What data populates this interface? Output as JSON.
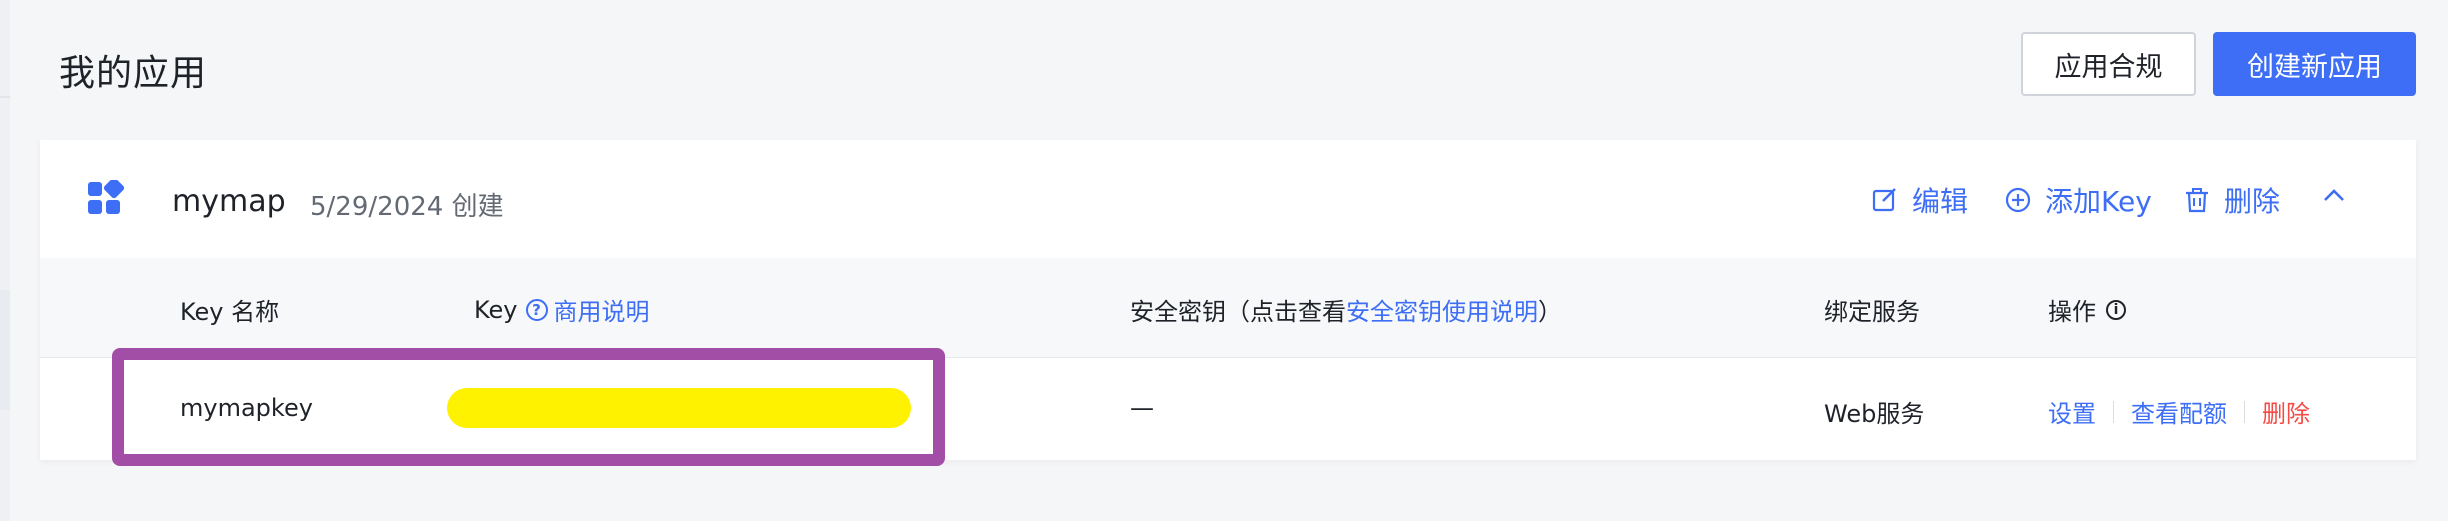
{
  "page": {
    "title": "我的应用",
    "compliance_button": "应用合规",
    "create_button": "创建新应用"
  },
  "app": {
    "name": "mymap",
    "created": "5/29/2024 创建",
    "actions": {
      "edit": "编辑",
      "add_key": "添加Key",
      "delete": "删除"
    }
  },
  "table": {
    "headers": {
      "key_name": "Key 名称",
      "key": "Key",
      "key_help": "商用说明",
      "secret_prefix": "安全密钥（点击查看",
      "secret_link": "安全密钥使用说明",
      "secret_suffix": "）",
      "service": "绑定服务",
      "ops": "操作"
    },
    "rows": [
      {
        "key_name": "mymapkey",
        "secret": "—",
        "service": "Web服务",
        "ops": {
          "settings": "设置",
          "quota": "查看配额",
          "delete": "删除"
        }
      }
    ]
  },
  "colors": {
    "primary": "#3d6ef5",
    "danger": "#f54a45",
    "redaction": "#fff200",
    "highlight": "#a34ea6"
  }
}
